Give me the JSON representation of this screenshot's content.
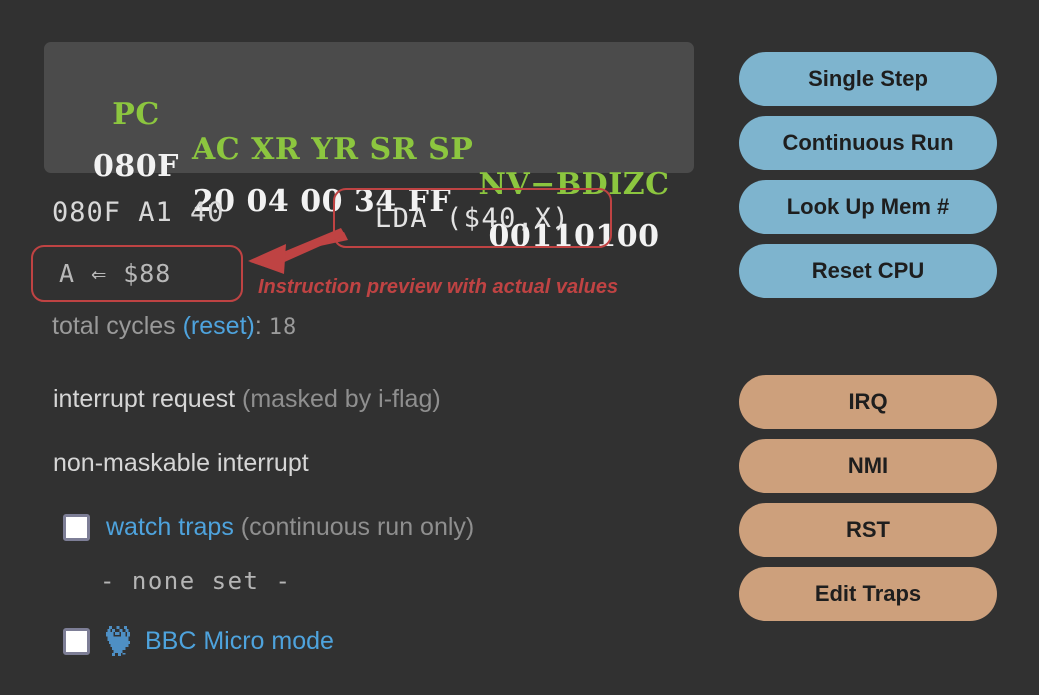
{
  "colors": {
    "background": "#313131",
    "panel": "#4b4b4b",
    "register_header": "#8cc63f",
    "register_value": "#f2f2f2",
    "annotation_red": "#bf4343",
    "link_blue": "#4ea3dd",
    "button_blue": "#7eb4ce",
    "button_tan": "#cda07c"
  },
  "registers": {
    "headers": {
      "pc": "PC",
      "mid": "AC XR YR SR SP",
      "flags": "NV−BDIZC"
    },
    "values": {
      "pc": "080F",
      "mid": "20 04 00 34 FF",
      "flags": "00110100"
    }
  },
  "disassembly": {
    "line": "080F A1 40",
    "mnemonic": "LDA ($40,X)",
    "preview": "A ⇐ $88"
  },
  "annotation": {
    "caption": "Instruction preview with actual values",
    "arrow_icon": "arrow-left-icon"
  },
  "cycles": {
    "label": "total cycles ",
    "reset_link": "(reset)",
    "colon": ": ",
    "value": "18"
  },
  "interrupts": {
    "irq_label": "interrupt request ",
    "irq_note": "(masked by i-flag)",
    "nmi_label": "non-maskable interrupt"
  },
  "options": {
    "watch_traps_link": "watch traps",
    "watch_traps_note": " (continuous run only)",
    "traps_list": "- none set -",
    "bbc_icon": "owl-icon",
    "bbc_label": "BBC Micro mode"
  },
  "buttons": {
    "control": [
      {
        "label": "Single Step"
      },
      {
        "label": "Continuous Run"
      },
      {
        "label": "Look Up Mem #"
      },
      {
        "label": "Reset CPU"
      }
    ],
    "interrupt": [
      {
        "label": "IRQ"
      },
      {
        "label": "NMI"
      },
      {
        "label": "RST"
      },
      {
        "label": "Edit Traps"
      }
    ]
  }
}
